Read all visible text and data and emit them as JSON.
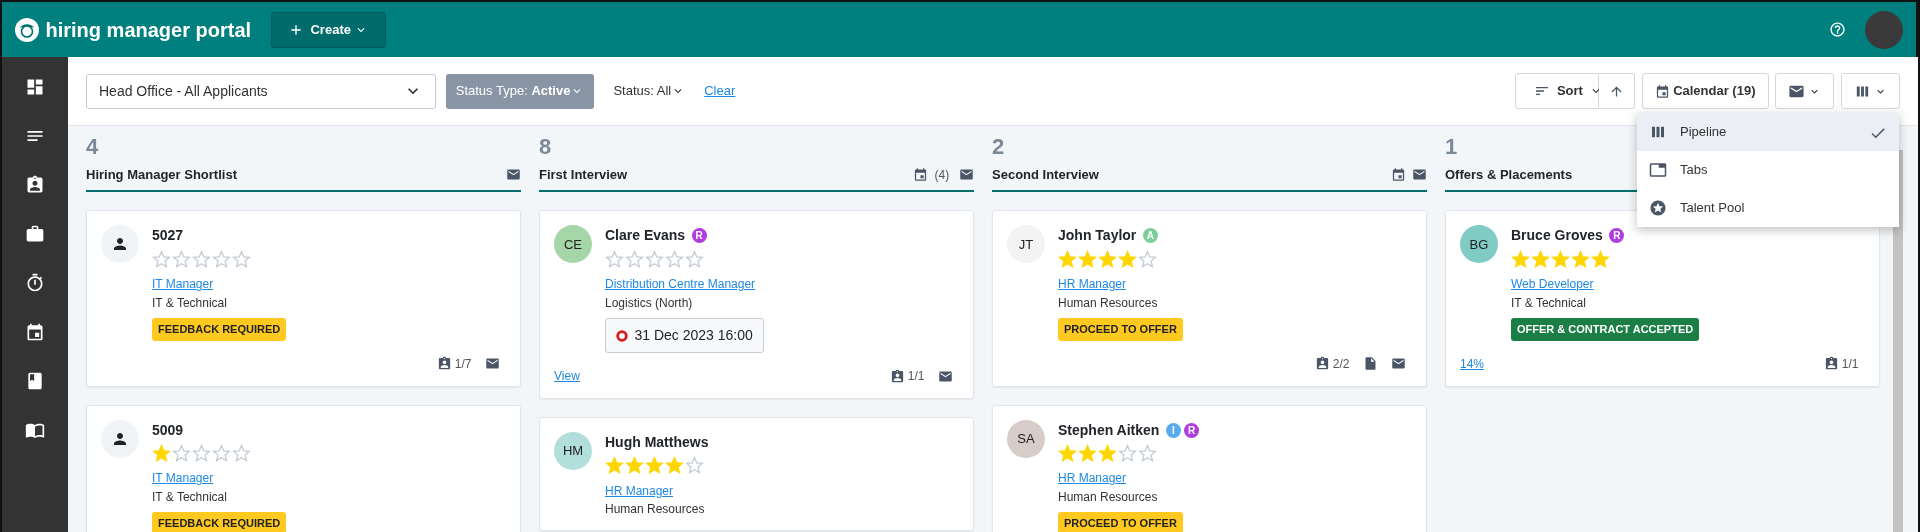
{
  "header": {
    "title": "hiring manager portal",
    "create_button": "Create"
  },
  "sidebar": {
    "items": [
      {
        "kind": "dashboard"
      },
      {
        "kind": "list"
      },
      {
        "kind": "clipboard"
      },
      {
        "kind": "briefcase"
      },
      {
        "kind": "timer"
      },
      {
        "kind": "calendar"
      },
      {
        "kind": "book"
      },
      {
        "kind": "open-book"
      }
    ]
  },
  "filters": {
    "location": "Head Office - All Applicants",
    "status_type": "Status Type: **Active**",
    "status": "Status: All",
    "clear": "Clear"
  },
  "toolbar": {
    "sort": "Sort",
    "calendar": "Calendar (19)"
  },
  "view_menu": [
    {
      "kind": "pipeline",
      "label": "Pipeline",
      "selected": true
    },
    {
      "kind": "tabs",
      "label": "Tabs",
      "selected": false
    },
    {
      "kind": "star",
      "label": "Talent Pool",
      "selected": false
    }
  ],
  "columns": [
    {
      "count": "4",
      "title": "Hiring Manager Shortlist",
      "actions": [
        {
          "kind": "mail"
        }
      ],
      "cards": [
        {
          "avatar": {
            "kind": "person"
          },
          "name": "5027",
          "stars": 0,
          "job": "IT Manager",
          "department": "IT & Technical",
          "tag": {
            "text": "FEEDBACK REQUIRED",
            "kind": "warning"
          },
          "footer": [
            {
              "kind": "feedback",
              "text": "1/7"
            },
            {
              "kind": "mail"
            }
          ]
        },
        {
          "avatar": {
            "kind": "person"
          },
          "name": "5009",
          "stars": 1,
          "job": "IT Manager",
          "department": "IT & Technical",
          "tag": {
            "text": "FEEDBACK REQUIRED",
            "kind": "warning"
          }
        }
      ]
    },
    {
      "count": "8",
      "title": "First Interview",
      "actions": [
        {
          "kind": "calendar",
          "text": "(4)"
        },
        {
          "kind": "mail"
        }
      ],
      "cards": [
        {
          "avatar": {
            "kind": "initials",
            "text": "CE",
            "color": "#a5d6a7"
          },
          "name": "Clare Evans",
          "badges": [
            {
              "letter": "R",
              "color": "#b03de0"
            }
          ],
          "stars": 0,
          "job": "Distribution Centre Manager",
          "department": "Logistics (North)",
          "event": "31 Dec 2023 16:00",
          "link": "View",
          "footer": [
            {
              "kind": "feedback",
              "text": "1/1"
            },
            {
              "kind": "mail"
            }
          ]
        },
        {
          "avatar": {
            "kind": "initials",
            "text": "HM",
            "color": "#b2dfdb"
          },
          "name": "Hugh Matthews",
          "stars": 4,
          "job": "HR Manager",
          "department": "Human Resources"
        }
      ]
    },
    {
      "count": "2",
      "title": "Second Interview",
      "actions": [
        {
          "kind": "calendar"
        },
        {
          "kind": "mail"
        }
      ],
      "cards": [
        {
          "avatar": {
            "kind": "initials",
            "text": "JT",
            "color": "#f3f3f3"
          },
          "name": "John Taylor",
          "badges": [
            {
              "letter": "A",
              "color": "#7ccf98"
            }
          ],
          "stars": 4,
          "job": "HR Manager",
          "department": "Human Resources",
          "tag": {
            "text": "PROCEED TO OFFER",
            "kind": "warning"
          },
          "footer": [
            {
              "kind": "feedback",
              "text": "2/2"
            },
            {
              "kind": "document"
            },
            {
              "kind": "mail"
            }
          ]
        },
        {
          "avatar": {
            "kind": "initials",
            "text": "SA",
            "color": "#d7ccc8"
          },
          "name": "Stephen Aitken",
          "badges": [
            {
              "letter": "I",
              "color": "#5aaaf0"
            },
            {
              "letter": "R",
              "color": "#b03de0"
            }
          ],
          "stars": 3,
          "job": "HR Manager",
          "department": "Human Resources",
          "tag": {
            "text": "PROCEED TO OFFER",
            "kind": "warning"
          }
        }
      ]
    },
    {
      "count": "1",
      "title": "Offers & Placements",
      "cards": [
        {
          "avatar": {
            "kind": "initials",
            "text": "BG",
            "color": "#80cbc4"
          },
          "name": "Bruce Groves",
          "badges": [
            {
              "letter": "R",
              "color": "#b03de0"
            }
          ],
          "stars": 5,
          "job": "Web Developer",
          "department": "IT & Technical",
          "tag": {
            "text": "OFFER & CONTRACT ACCEPTED",
            "kind": "success"
          },
          "link": "14%",
          "footer": [
            {
              "kind": "feedback",
              "text": "1/1"
            }
          ]
        }
      ]
    }
  ]
}
